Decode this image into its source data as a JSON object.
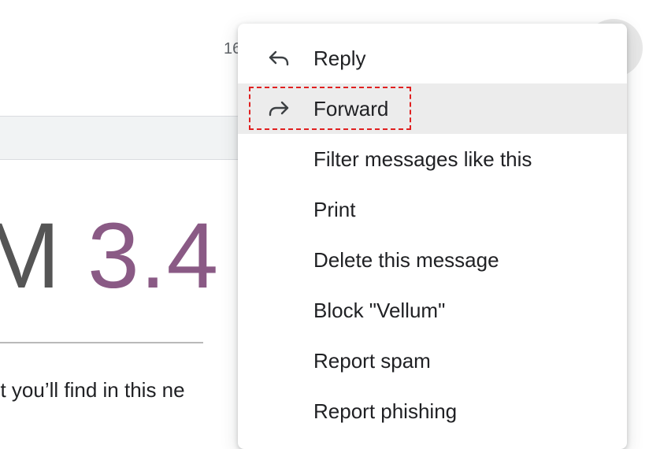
{
  "email": {
    "timestamp": "16",
    "hero_part1": "M ",
    "hero_part2": "3.4",
    "body_snippet": "nt you’ll find in this ne"
  },
  "menu": {
    "items": [
      {
        "label": "Reply",
        "icon": "reply-icon"
      },
      {
        "label": "Forward",
        "icon": "forward-icon"
      },
      {
        "label": "Filter messages like this"
      },
      {
        "label": "Print"
      },
      {
        "label": "Delete this message"
      },
      {
        "label": "Block \"Vellum\""
      },
      {
        "label": "Report spam"
      },
      {
        "label": "Report phishing"
      }
    ],
    "highlighted": "Forward"
  },
  "colors": {
    "menu_highlight": "#ececec",
    "focus_outline": "#e02020",
    "hero_accent": "#8a5a85"
  }
}
